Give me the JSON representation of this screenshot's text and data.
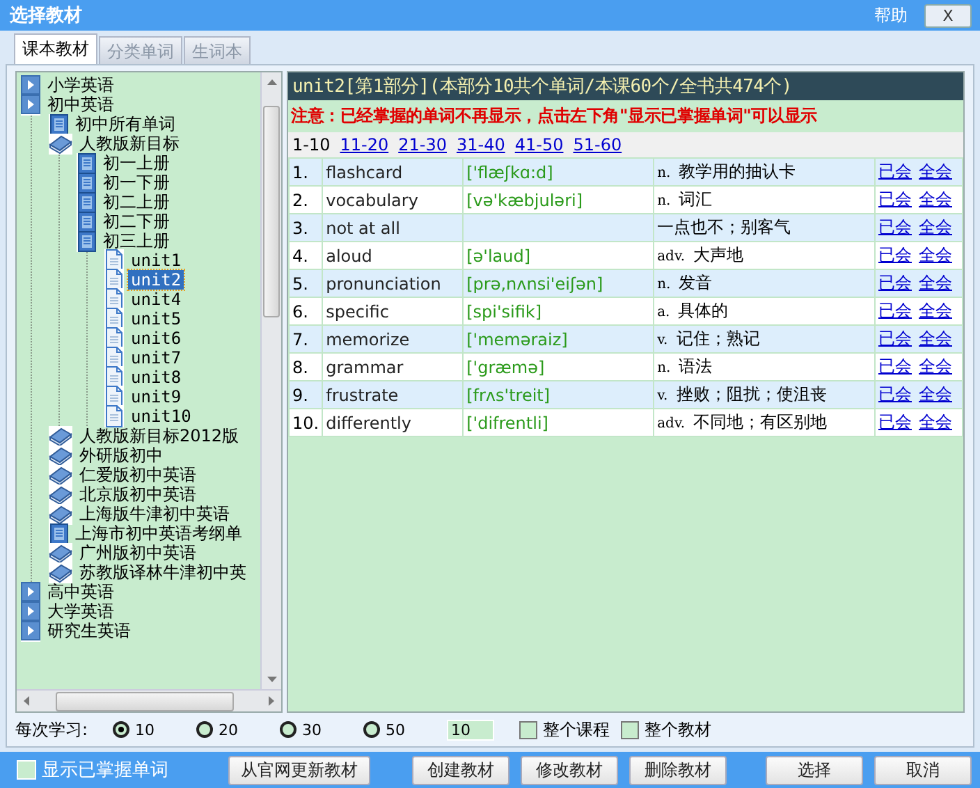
{
  "window": {
    "title": "选择教材",
    "help": "帮助",
    "close": "X"
  },
  "tabs": [
    {
      "label": "课本教材",
      "selected": true
    },
    {
      "label": "分类单词",
      "selected": false
    },
    {
      "label": "生词本",
      "selected": false
    }
  ],
  "tree": [
    {
      "label": "小学英语",
      "kind": "category",
      "selected": false
    },
    {
      "label": "初中英语",
      "kind": "category",
      "selected": false,
      "children": [
        {
          "label": "初中所有单词",
          "kind": "book",
          "selected": false
        },
        {
          "label": "人教版新目标",
          "kind": "series",
          "selected": false,
          "children": [
            {
              "label": "初一上册",
              "kind": "book",
              "selected": false
            },
            {
              "label": "初一下册",
              "kind": "book",
              "selected": false
            },
            {
              "label": "初二上册",
              "kind": "book",
              "selected": false
            },
            {
              "label": "初二下册",
              "kind": "book",
              "selected": false
            },
            {
              "label": "初三上册",
              "kind": "book",
              "selected": false,
              "children": [
                {
                  "label": "unit1",
                  "kind": "unit",
                  "selected": false
                },
                {
                  "label": "unit2",
                  "kind": "unit",
                  "selected": true
                },
                {
                  "label": "unit4",
                  "kind": "unit",
                  "selected": false
                },
                {
                  "label": "unit5",
                  "kind": "unit",
                  "selected": false
                },
                {
                  "label": "unit6",
                  "kind": "unit",
                  "selected": false
                },
                {
                  "label": "unit7",
                  "kind": "unit",
                  "selected": false
                },
                {
                  "label": "unit8",
                  "kind": "unit",
                  "selected": false
                },
                {
                  "label": "unit9",
                  "kind": "unit",
                  "selected": false
                },
                {
                  "label": "unit10",
                  "kind": "unit",
                  "selected": false
                }
              ]
            }
          ]
        },
        {
          "label": "人教版新目标2012版",
          "kind": "series",
          "selected": false
        },
        {
          "label": "外研版初中",
          "kind": "series",
          "selected": false
        },
        {
          "label": "仁爱版初中英语",
          "kind": "series",
          "selected": false
        },
        {
          "label": "北京版初中英语",
          "kind": "series",
          "selected": false
        },
        {
          "label": "上海版牛津初中英语",
          "kind": "series",
          "selected": false
        },
        {
          "label": "上海市初中英语考纲单",
          "kind": "book",
          "selected": false
        },
        {
          "label": "广州版初中英语",
          "kind": "series",
          "selected": false
        },
        {
          "label": "苏教版译林牛津初中英",
          "kind": "series",
          "selected": false
        }
      ]
    },
    {
      "label": "高中英语",
      "kind": "category",
      "selected": false
    },
    {
      "label": "大学英语",
      "kind": "category",
      "selected": false
    },
    {
      "label": "研究生英语",
      "kind": "category",
      "selected": false
    }
  ],
  "show_mastered": {
    "label": "显示已掌握单词",
    "checked": false
  },
  "lesson": {
    "header": "unit2[第1部分](本部分10共个单词/本课60个/全书共474个)",
    "notice": "注意：已经掌握的单词不再显示，点击左下角\"显示已掌握单词\"可以显示",
    "pages": [
      {
        "label": "1-10",
        "selected": true
      },
      {
        "label": "11-20",
        "selected": false
      },
      {
        "label": "21-30",
        "selected": false
      },
      {
        "label": "31-40",
        "selected": false
      },
      {
        "label": "41-50",
        "selected": false
      },
      {
        "label": "51-60",
        "selected": false
      }
    ],
    "rows": [
      {
        "number": "1.",
        "word": "flashcard",
        "phonetic": "['flæʃkɑ:d]",
        "pos": "n.",
        "meaning": "教学用的抽认卡",
        "actions": [
          "已会",
          "全会"
        ]
      },
      {
        "number": "2.",
        "word": "vocabulary",
        "phonetic": "[və'kæbjuləri]",
        "pos": "n.",
        "meaning": "词汇",
        "actions": [
          "已会",
          "全会"
        ]
      },
      {
        "number": "3.",
        "word": "not at all",
        "meaning": "一点也不；别客气",
        "actions": [
          "已会",
          "全会"
        ]
      },
      {
        "number": "4.",
        "word": "aloud",
        "phonetic": "[ə'laud]",
        "pos": "adv.",
        "meaning": "大声地",
        "actions": [
          "已会",
          "全会"
        ]
      },
      {
        "number": "5.",
        "word": "pronunciation",
        "phonetic": "[prə,nʌnsi'eiʃən]",
        "pos": "n.",
        "meaning": "发音",
        "actions": [
          "已会",
          "全会"
        ]
      },
      {
        "number": "6.",
        "word": "specific",
        "phonetic": "[spi'sifik]",
        "pos": "a.",
        "meaning": "具体的",
        "actions": [
          "已会",
          "全会"
        ]
      },
      {
        "number": "7.",
        "word": "memorize",
        "phonetic": "['meməraiz]",
        "pos": "v.",
        "meaning": "记住；熟记",
        "actions": [
          "已会",
          "全会"
        ]
      },
      {
        "number": "8.",
        "word": "grammar",
        "phonetic": "['græmə]",
        "pos": "n.",
        "meaning": "语法",
        "actions": [
          "已会",
          "全会"
        ]
      },
      {
        "number": "9.",
        "word": "frustrate",
        "phonetic": "[frʌs'treit]",
        "pos": "v.",
        "meaning": "挫败；阻扰；使沮丧",
        "actions": [
          "已会",
          "全会"
        ]
      },
      {
        "number": "10.",
        "word": "differently",
        "phonetic": "['difrentli]",
        "pos": "adv.",
        "meaning": "不同地；有区别地",
        "actions": [
          "已会",
          "全会"
        ]
      }
    ]
  },
  "study": {
    "label": "每次学习:",
    "options": [
      {
        "label": "10",
        "selected": true
      },
      {
        "label": "20",
        "selected": false
      },
      {
        "label": "30",
        "selected": false
      },
      {
        "label": "50",
        "selected": false
      }
    ],
    "count": "10",
    "scopes": [
      {
        "label": "整个课程",
        "checked": false
      },
      {
        "label": "整个教材",
        "checked": false
      }
    ]
  },
  "buttons": [
    {
      "label": "从官网更新教材",
      "kind": "left"
    },
    {
      "label": "创建教材",
      "kind": "left"
    },
    {
      "label": "修改教材",
      "kind": "left"
    },
    {
      "label": "删除教材",
      "kind": "left"
    },
    {
      "label": "选择",
      "kind": "right"
    },
    {
      "label": "取消",
      "kind": "right"
    }
  ]
}
